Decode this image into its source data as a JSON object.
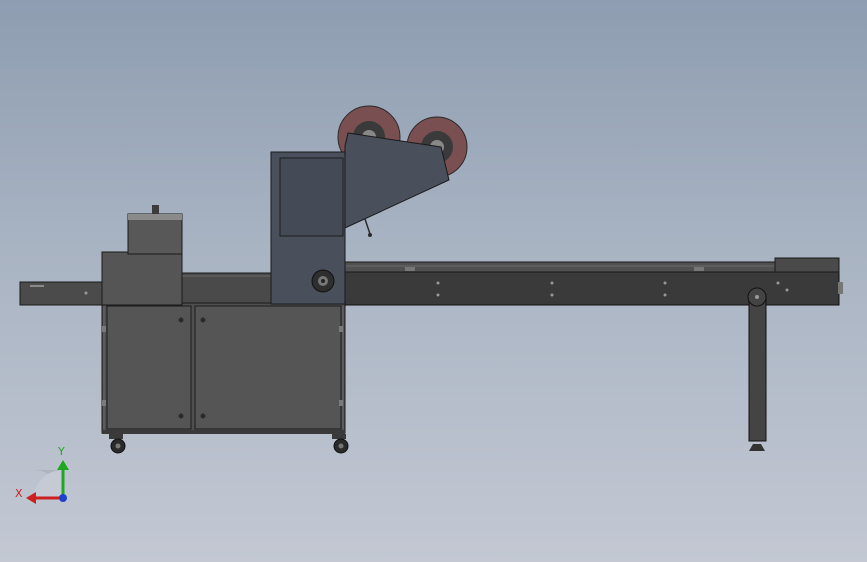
{
  "scene": {
    "model": "packaging-machine-side-view",
    "colors": {
      "background_top": "#8e9db1",
      "background_bottom": "#c3c8d3",
      "machine_body": "#4b4b4b",
      "machine_dark": "#2f2f2f",
      "cabinet_panel": "#545454",
      "film_reel": "#7a4f52",
      "feed_cover": "#4a4f5c"
    }
  },
  "triad": {
    "x_label": "X",
    "y_label": "Y",
    "x_color": "#cc1f1f",
    "y_color": "#1fa81f",
    "z_color": "#1f3fcc"
  }
}
